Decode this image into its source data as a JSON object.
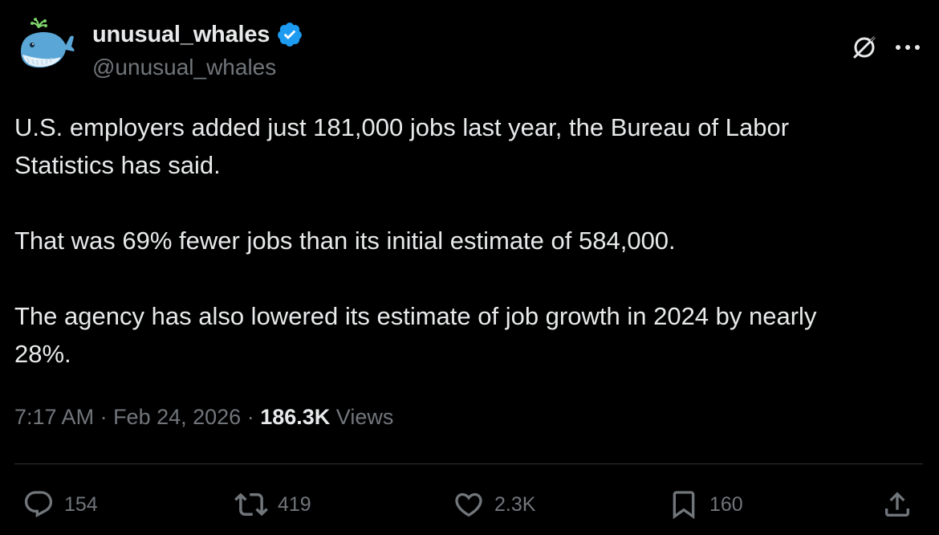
{
  "author": {
    "display_name": "unusual_whales",
    "handle": "@unusual_whales",
    "verified": true
  },
  "tweet": {
    "paragraphs": [
      "U.S. employers added just 181,000 jobs last year, the Bureau of Labor\nStatistics has said.",
      "That was 69% fewer jobs than its initial estimate of 584,000.",
      "The agency has also lowered its estimate of job growth in 2024 by nearly\n28%."
    ],
    "time": "7:17 AM",
    "date": "Feb 24, 2026",
    "views_count": "186.3K",
    "views_label": "Views"
  },
  "actions": {
    "replies": "154",
    "reposts": "419",
    "likes": "2.3K",
    "bookmarks": "160"
  },
  "colors": {
    "background": "#000000",
    "text": "#e7e9ea",
    "muted": "#71767b",
    "divider": "#2f3336",
    "verified": "#1d9bf0"
  },
  "icons": {
    "verified": "verified-badge-icon",
    "grok": "grok-icon",
    "more": "more-icon",
    "reply": "reply-icon",
    "repost": "repost-icon",
    "like": "heart-icon",
    "bookmark": "bookmark-icon",
    "share": "share-icon"
  }
}
